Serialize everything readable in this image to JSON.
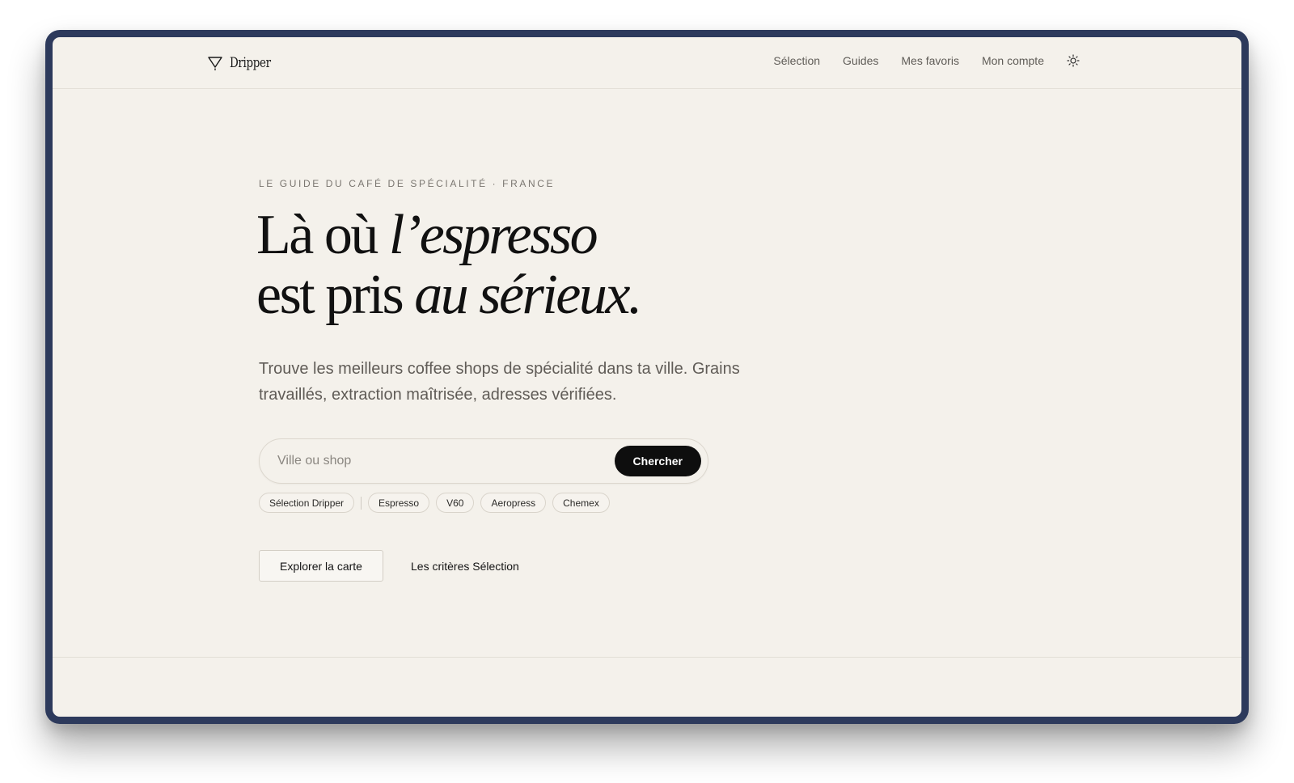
{
  "brand": {
    "name": "Dripper",
    "icon": "dripper-cone-icon"
  },
  "nav": {
    "items": [
      {
        "label": "Sélection"
      },
      {
        "label": "Guides"
      },
      {
        "label": "Mes favoris"
      },
      {
        "label": "Mon compte"
      }
    ],
    "theme_icon": "sun-icon"
  },
  "hero": {
    "eyebrow": "Le guide du café de spécialité · France",
    "headline": {
      "line1_plain": "Là où ",
      "line1_italic": "l’espresso",
      "line2_plain": "est pris ",
      "line2_italic": "au sérieux."
    },
    "lead": "Trouve les meilleurs coffee shops de spécialité dans ta ville. Grains travaillés, extraction maîtrisée, adresses vérifiées."
  },
  "search": {
    "placeholder": "Ville ou shop",
    "value": "",
    "button_label": "Chercher"
  },
  "filters": {
    "featured": "Sélection Dripper",
    "methods": [
      "Espresso",
      "V60",
      "Aeropress",
      "Chemex"
    ]
  },
  "actions": {
    "primary_label": "Explorer la carte",
    "secondary_label": "Les critères Sélection"
  },
  "colors": {
    "background": "#f4f1eb",
    "frame": "#2d3a5c",
    "text": "#111111",
    "muted": "#605c57",
    "button": "#0e0e0e"
  }
}
